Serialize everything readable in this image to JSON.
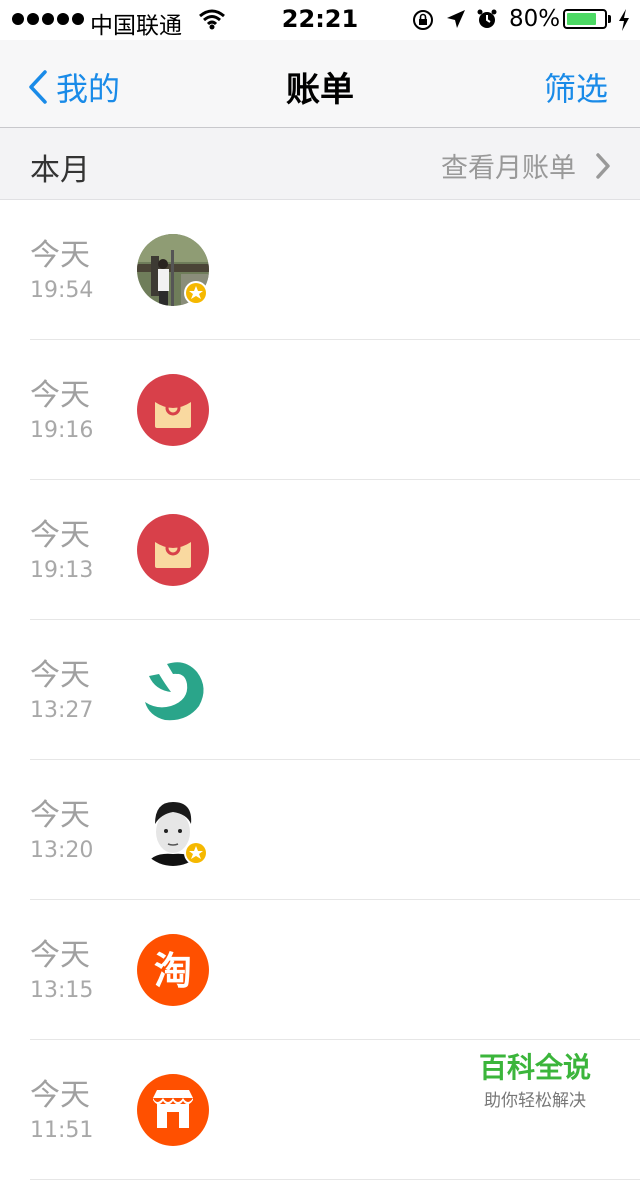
{
  "status_bar": {
    "carrier": "中国联通",
    "time": "22:21",
    "battery_percent": "80%",
    "battery_level": 0.8
  },
  "nav": {
    "back_label": "我的",
    "title": "账单",
    "filter_label": "筛选"
  },
  "section": {
    "month_label": "本月",
    "view_month_label": "查看月账单"
  },
  "bills": [
    {
      "day": "今天",
      "time": "19:54",
      "icon": "user-photo-avatar"
    },
    {
      "day": "今天",
      "time": "19:16",
      "icon": "red-envelope-icon"
    },
    {
      "day": "今天",
      "time": "19:13",
      "icon": "red-envelope-icon"
    },
    {
      "day": "今天",
      "time": "13:27",
      "icon": "green-brand-logo-icon"
    },
    {
      "day": "今天",
      "time": "13:20",
      "icon": "user-portrait-avatar"
    },
    {
      "day": "今天",
      "time": "13:15",
      "icon": "taobao-icon"
    },
    {
      "day": "今天",
      "time": "11:51",
      "icon": "shop-icon"
    }
  ],
  "watermark": {
    "title": "百科全说",
    "subtitle": "助你轻松解决"
  },
  "colors": {
    "accent": "#1a8be8",
    "red_envelope": "#d8404a",
    "envelope_face": "#f9d9a0",
    "taobao": "#ff5000",
    "green_logo": "#2aa58a",
    "badge": "#f5b800",
    "battery": "#4cd964"
  }
}
